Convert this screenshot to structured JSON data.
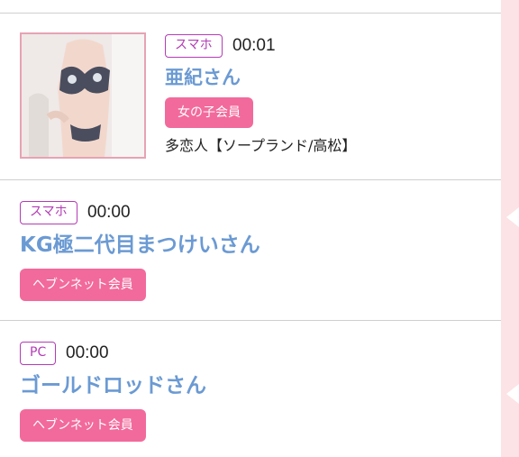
{
  "colors": {
    "accent_name": "#6b9ad3",
    "badge_border": "#b33bb5",
    "member_badge_bg": "#f26a9b",
    "right_strip": "#fce3e6",
    "thumb_border": "#e6a3b3"
  },
  "entries": [
    {
      "device": "スマホ",
      "time": "00:01",
      "name": "亜紀さん",
      "member_type": "女の子会員",
      "shop": "多恋人【ソープランド/高松】",
      "thumbnail_icon": "profile-photo"
    },
    {
      "device": "スマホ",
      "time": "00:00",
      "name": "KG極二代目まつけいさん",
      "member_type": "ヘブンネット会員"
    },
    {
      "device": "PC",
      "time": "00:00",
      "name": "ゴールドロッドさん",
      "member_type": "ヘブンネット会員"
    }
  ]
}
